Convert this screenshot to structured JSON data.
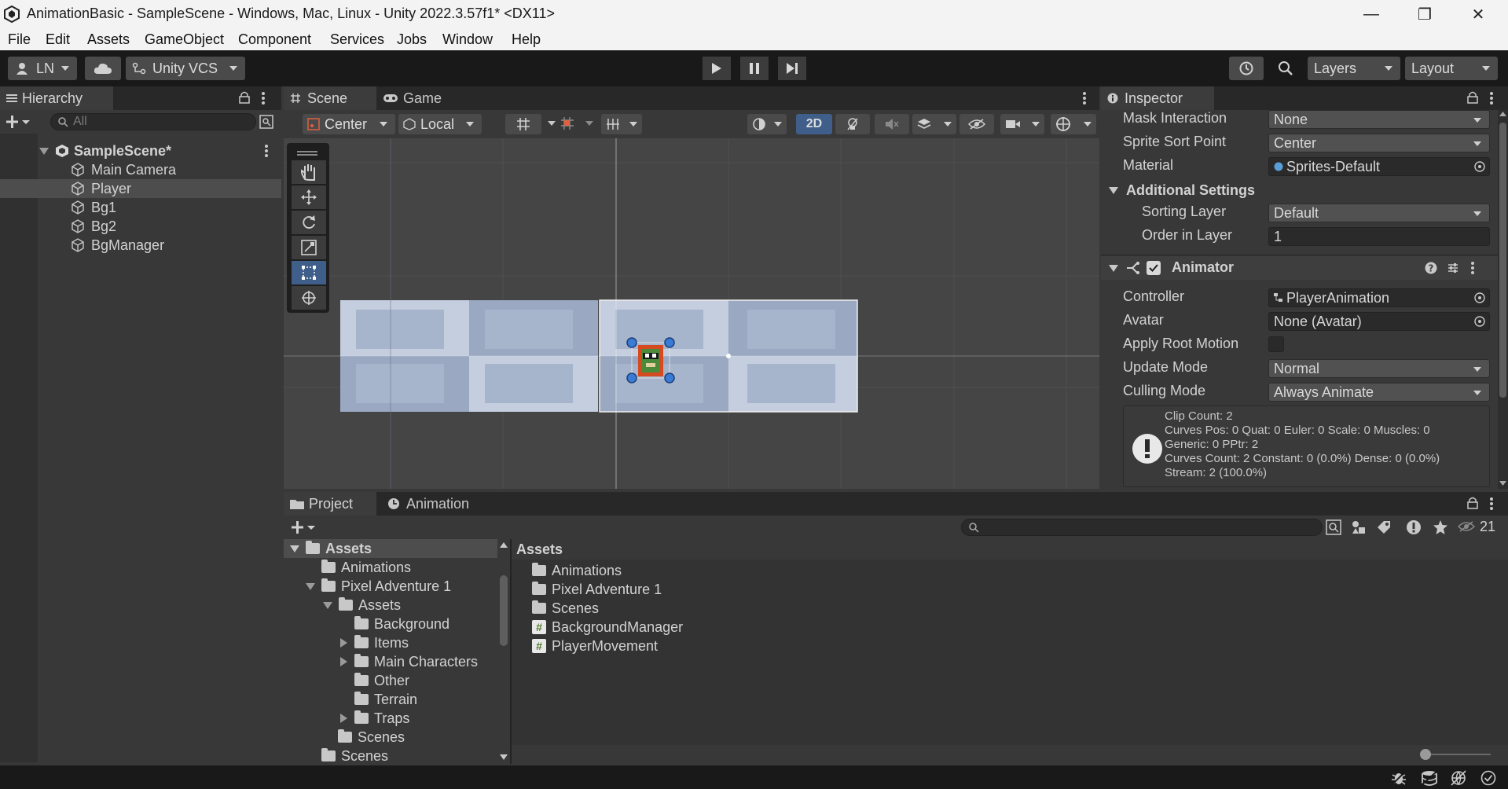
{
  "window": {
    "title": "AnimationBasic - SampleScene - Windows, Mac, Linux - Unity 2022.3.57f1* <DX11>",
    "minimize": "—",
    "maximize": "❐",
    "close": "✕"
  },
  "menu": [
    "File",
    "Edit",
    "Assets",
    "GameObject",
    "Component",
    "Services",
    "Jobs",
    "Window",
    "Help"
  ],
  "toolbar": {
    "account": "LN",
    "vcs": "Unity VCS",
    "layers": "Layers",
    "layout": "Layout"
  },
  "hierarchy": {
    "tab": "Hierarchy",
    "search_placeholder": "All",
    "scene": "SampleScene*",
    "items": [
      "Main Camera",
      "Player",
      "Bg1",
      "Bg2",
      "BgManager"
    ],
    "selected": "Player"
  },
  "scene_view": {
    "tabs": [
      "Scene",
      "Game"
    ],
    "pivot": "Center",
    "space": "Local",
    "mode_2d": "2D"
  },
  "inspector": {
    "tab": "Inspector",
    "rows": [
      {
        "label": "Mask Interaction",
        "value": "None",
        "type": "dropdown"
      },
      {
        "label": "Sprite Sort Point",
        "value": "Center",
        "type": "dropdown"
      },
      {
        "label": "Material",
        "value": "Sprites-Default",
        "type": "object"
      }
    ],
    "additional_settings": "Additional Settings",
    "sorting_layer_label": "Sorting Layer",
    "sorting_layer": "Default",
    "order_label": "Order in Layer",
    "order": "1",
    "animator": {
      "title": "Animator",
      "controller_label": "Controller",
      "controller": "PlayerAnimation",
      "avatar_label": "Avatar",
      "avatar": "None (Avatar)",
      "root_motion_label": "Apply Root Motion",
      "update_mode_label": "Update Mode",
      "update_mode": "Normal",
      "culling_mode_label": "Culling Mode",
      "culling_mode": "Always Animate",
      "info": [
        "Clip Count: 2",
        "Curves Pos: 0 Quat: 0 Euler: 0 Scale: 0 Muscles: 0",
        "Generic: 0 PPtr: 2",
        "Curves Count: 2 Constant: 0 (0.0%) Dense: 0 (0.0%)",
        "Stream: 2 (100.0%)"
      ]
    }
  },
  "project": {
    "tabs": [
      "Project",
      "Animation"
    ],
    "hidden_count": "21",
    "tree": {
      "root": "Assets",
      "animations": "Animations",
      "pixel_adventure": "Pixel Adventure 1",
      "pa_assets": "Assets",
      "background": "Background",
      "items": "Items",
      "main_characters": "Main Characters",
      "other": "Other",
      "terrain": "Terrain",
      "traps": "Traps",
      "pa_scenes": "Scenes",
      "scenes": "Scenes"
    },
    "breadcrumb": "Assets",
    "contents": [
      {
        "name": "Animations",
        "kind": "folder"
      },
      {
        "name": "Pixel Adventure 1",
        "kind": "folder"
      },
      {
        "name": "Scenes",
        "kind": "folder"
      },
      {
        "name": "BackgroundManager",
        "kind": "script"
      },
      {
        "name": "PlayerMovement",
        "kind": "script"
      }
    ]
  }
}
